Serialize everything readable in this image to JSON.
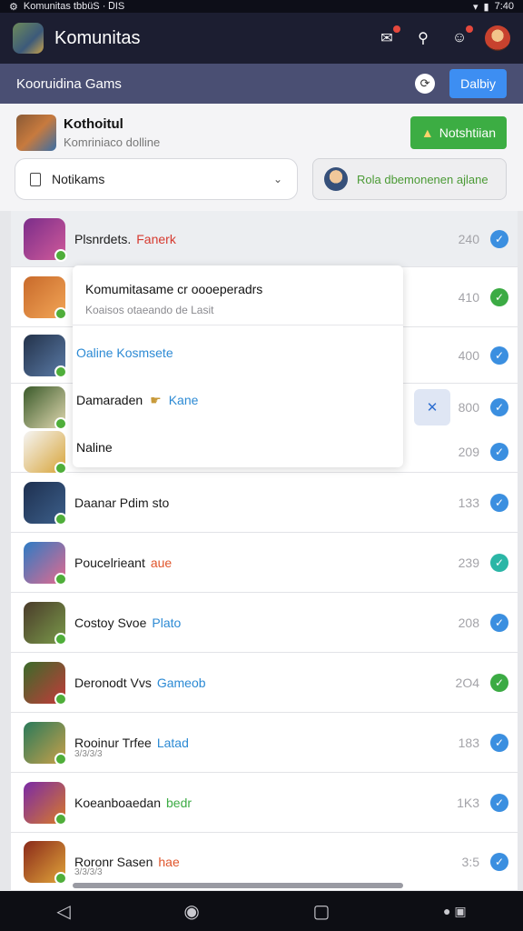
{
  "status_bar": {
    "text": "Komunitas tbbüS · ᎠIS",
    "time": "7:40"
  },
  "app": {
    "title": "Komunitas"
  },
  "sub_header": {
    "title": "Kooruidina Gams",
    "button_label": "Dalbiy"
  },
  "profile": {
    "name": "Kothoitul",
    "subtitle": "Komriniaco dolline",
    "green_button_label": "Notshtiian",
    "dropdown_label": "Notikams",
    "pill_label": "Rola dbemonenen ajlane"
  },
  "popup": {
    "title": "Komumitasame cr oooeperadrs",
    "subtitle": "Koaisos otaeando de Lasit",
    "option1": "Oaline Kosmsete",
    "option2_main": "Damaraden",
    "option2_accent": "Kane",
    "option3": "Naline"
  },
  "rows": [
    {
      "name": "Plsnrdets.",
      "tag": "Fanerk",
      "tag_color": "#d63a2f",
      "sub": "",
      "count": "240",
      "check_color": "#3b8fe0",
      "thumb": [
        "#7b2d8a",
        "#d05a9a"
      ]
    },
    {
      "name": "",
      "tag": "",
      "tag_color": "#333333",
      "sub": "",
      "count": "410",
      "check_color": "#3cab44",
      "thumb": [
        "#c86a2b",
        "#f2a556"
      ]
    },
    {
      "name": "",
      "tag": "",
      "tag_color": "#333333",
      "sub": "",
      "count": "400",
      "check_color": "#3b8fe0",
      "thumb": [
        "#23324a",
        "#5a7aa6"
      ]
    },
    {
      "name": "",
      "tag": "",
      "tag_color": "#333333",
      "sub": "",
      "count": "800",
      "check_color": "#3b8fe0",
      "thumb": [
        "#3a5a2a",
        "#e0d8b0"
      ]
    },
    {
      "name": "",
      "tag": "",
      "tag_color": "#333333",
      "sub": "",
      "count": "209",
      "check_color": "#3b8fe0",
      "thumb": [
        "#f5f5f5",
        "#d8a53a"
      ]
    },
    {
      "name": "Daanar Pdim sto",
      "tag": "",
      "tag_color": "#333333",
      "sub": "",
      "count": "133",
      "check_color": "#3b8fe0",
      "thumb": [
        "#1e3050",
        "#3c5f8a"
      ]
    },
    {
      "name": "Poucelrieant",
      "tag": "aue",
      "tag_color": "#e0552b",
      "sub": "",
      "count": "239",
      "check_color": "#2bb6a6",
      "thumb": [
        "#2d7bc4",
        "#e46a8f"
      ]
    },
    {
      "name": "Costoy Svoe",
      "tag": "Plato",
      "tag_color": "#2c8ad4",
      "sub": "",
      "count": "208",
      "check_color": "#3b8fe0",
      "thumb": [
        "#4a3b2a",
        "#7a9a4a"
      ]
    },
    {
      "name": "Deronodt Vvs",
      "tag": "Gameob",
      "tag_color": "#2c8ad4",
      "sub": "",
      "count": "2O4",
      "check_color": "#3cab44",
      "thumb": [
        "#3a6b2a",
        "#c43a3a"
      ]
    },
    {
      "name": "Rooinur Trfee",
      "tag": "Latad",
      "tag_color": "#2c8ad4",
      "sub": "3/3/3/3",
      "count": "183",
      "check_color": "#3b8fe0",
      "thumb": [
        "#2a7a5a",
        "#c8a04a"
      ]
    },
    {
      "name": "Koeanboaedan",
      "tag": "bedr",
      "tag_color": "#3cab44",
      "sub": "",
      "count": "1K3",
      "check_color": "#3b8fe0",
      "thumb": [
        "#7a2aa6",
        "#d87a2a"
      ]
    },
    {
      "name": "Roronr Sasen",
      "tag": "hae",
      "tag_color": "#e0552b",
      "sub": "3/3/3/3",
      "count": "3:5",
      "check_color": "#3b8fe0",
      "thumb": [
        "#8a2a1a",
        "#e0a43a"
      ]
    }
  ],
  "popup_side_button": "✕"
}
